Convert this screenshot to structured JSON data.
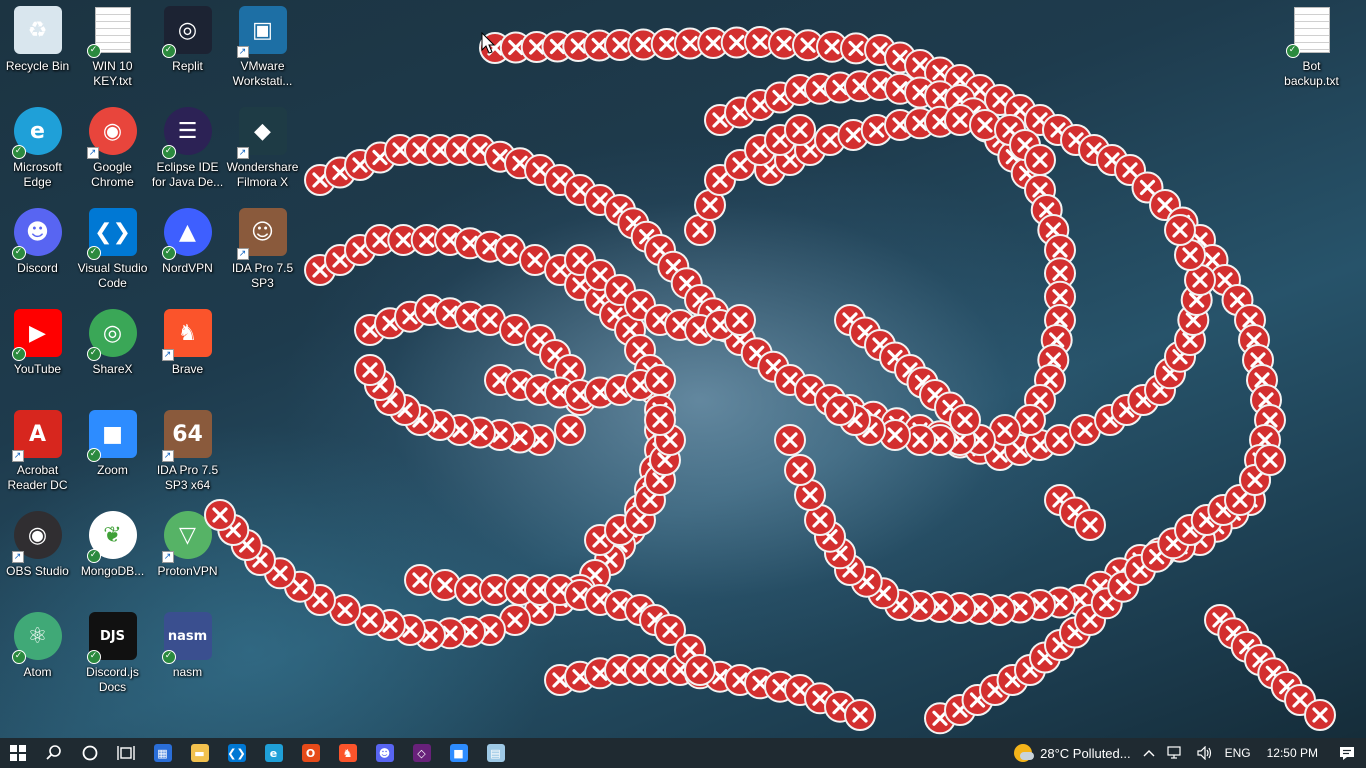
{
  "desktop": {
    "icons": [
      {
        "label": "Recycle Bin",
        "icon": "recycle-bin-icon",
        "color": "#d9e6ee",
        "glyph": "♻",
        "badge": "none"
      },
      {
        "label": "WIN 10 KEY.txt",
        "icon": "text-file-icon",
        "color": "#ffffff",
        "glyph": "",
        "badge": "sync"
      },
      {
        "label": "Replit",
        "icon": "replit-icon",
        "color": "#1c2333",
        "glyph": "◎",
        "badge": "sync"
      },
      {
        "label": "VMware Workstati...",
        "icon": "vmware-icon",
        "color": "#1d6fa5",
        "glyph": "▣",
        "badge": "shortcut"
      },
      {
        "label": "Microsoft Edge",
        "icon": "edge-icon",
        "color": "#1fa0d8",
        "glyph": "e",
        "badge": "sync"
      },
      {
        "label": "Google Chrome",
        "icon": "chrome-icon",
        "color": "#e8453c",
        "glyph": "◉",
        "badge": "shortcut"
      },
      {
        "label": "Eclipse IDE for Java De...",
        "icon": "eclipse-icon",
        "color": "#2c2255",
        "glyph": "☰",
        "badge": "sync"
      },
      {
        "label": "Wondershare Filmora X",
        "icon": "filmora-icon",
        "color": "#1e3b45",
        "glyph": "◆",
        "badge": "shortcut"
      },
      {
        "label": "Discord",
        "icon": "discord-icon",
        "color": "#5865f2",
        "glyph": "☻",
        "badge": "sync"
      },
      {
        "label": "Visual Studio Code",
        "icon": "vscode-icon",
        "color": "#0078d4",
        "glyph": "❮❯",
        "badge": "sync"
      },
      {
        "label": "NordVPN",
        "icon": "nordvpn-icon",
        "color": "#3e5fff",
        "glyph": "▲",
        "badge": "sync"
      },
      {
        "label": "IDA Pro 7.5 SP3",
        "icon": "ida-pro-icon",
        "color": "#8a5a3c",
        "glyph": "☺",
        "badge": "shortcut"
      },
      {
        "label": "YouTube",
        "icon": "youtube-icon",
        "color": "#ff0000",
        "glyph": "▶",
        "badge": "sync"
      },
      {
        "label": "ShareX",
        "icon": "sharex-icon",
        "color": "#3aa757",
        "glyph": "◎",
        "badge": "sync"
      },
      {
        "label": "Brave",
        "icon": "brave-icon",
        "color": "#fb542b",
        "glyph": "♞",
        "badge": "shortcut"
      },
      {
        "label": "",
        "icon": "",
        "color": "",
        "glyph": "",
        "badge": "none",
        "empty": true
      },
      {
        "label": "Acrobat Reader DC",
        "icon": "acrobat-icon",
        "color": "#d7261e",
        "glyph": "A",
        "badge": "shortcut"
      },
      {
        "label": "Zoom",
        "icon": "zoom-icon",
        "color": "#2d8cff",
        "glyph": "■",
        "badge": "sync"
      },
      {
        "label": "IDA Pro 7.5 SP3 x64",
        "icon": "ida-pro-x64-icon",
        "color": "#8a5a3c",
        "glyph": "64",
        "badge": "shortcut"
      },
      {
        "label": "",
        "icon": "",
        "color": "",
        "glyph": "",
        "badge": "none",
        "empty": true
      },
      {
        "label": "OBS Studio",
        "icon": "obs-icon",
        "color": "#302e31",
        "glyph": "◉",
        "badge": "shortcut"
      },
      {
        "label": "MongoDB...",
        "icon": "mongodb-icon",
        "color": "#ffffff",
        "glyph": "❦",
        "badge": "sync"
      },
      {
        "label": "ProtonVPN",
        "icon": "protonvpn-icon",
        "color": "#56b366",
        "glyph": "▽",
        "badge": "shortcut"
      },
      {
        "label": "",
        "icon": "",
        "color": "",
        "glyph": "",
        "badge": "none",
        "empty": true
      },
      {
        "label": "Atom",
        "icon": "atom-icon",
        "color": "#40a977",
        "glyph": "⚛",
        "badge": "sync"
      },
      {
        "label": "Discord.js Docs",
        "icon": "discordjs-icon",
        "color": "#111111",
        "glyph": "DJS",
        "badge": "sync"
      },
      {
        "label": "nasm",
        "icon": "nasm-icon",
        "color": "#3a4f8f",
        "glyph": "nasm",
        "badge": "sync"
      }
    ],
    "right_icons": [
      {
        "label": "Bot backup.txt",
        "icon": "text-file-icon",
        "color": "#ffffff",
        "glyph": "",
        "badge": "sync"
      }
    ]
  },
  "error_swarm": {
    "icon": "error-x-icon",
    "color": "#d32f2f"
  },
  "taskbar": {
    "start": "start-icon",
    "search": "search-icon",
    "cortana": "cortana-icon",
    "task_view": "task-view-icon",
    "apps": [
      {
        "name": "microsoft-store",
        "icon": "store-icon",
        "color": "#2a6ed8",
        "glyph": "▦"
      },
      {
        "name": "file-explorer",
        "icon": "folder-icon",
        "color": "#f2c14e",
        "glyph": "▬"
      },
      {
        "name": "vscode",
        "icon": "vscode-icon",
        "color": "#0078d4",
        "glyph": "❮❯"
      },
      {
        "name": "edge",
        "icon": "edge-icon",
        "color": "#1fa0d8",
        "glyph": "e"
      },
      {
        "name": "office",
        "icon": "office-icon",
        "color": "#e64a19",
        "glyph": "O"
      },
      {
        "name": "brave",
        "icon": "brave-icon",
        "color": "#fb542b",
        "glyph": "♞"
      },
      {
        "name": "discord",
        "icon": "discord-icon",
        "color": "#5865f2",
        "glyph": "☻"
      },
      {
        "name": "visual-studio",
        "icon": "visual-studio-icon",
        "color": "#68217a",
        "glyph": "◇"
      },
      {
        "name": "zoom",
        "icon": "zoom-icon",
        "color": "#2d8cff",
        "glyph": "■"
      },
      {
        "name": "notepad",
        "icon": "notepad-icon",
        "color": "#9ec9e6",
        "glyph": "▤"
      }
    ],
    "tray": {
      "weather": "28°C  Polluted...",
      "language": "ENG",
      "time": "12:50 PM"
    }
  }
}
